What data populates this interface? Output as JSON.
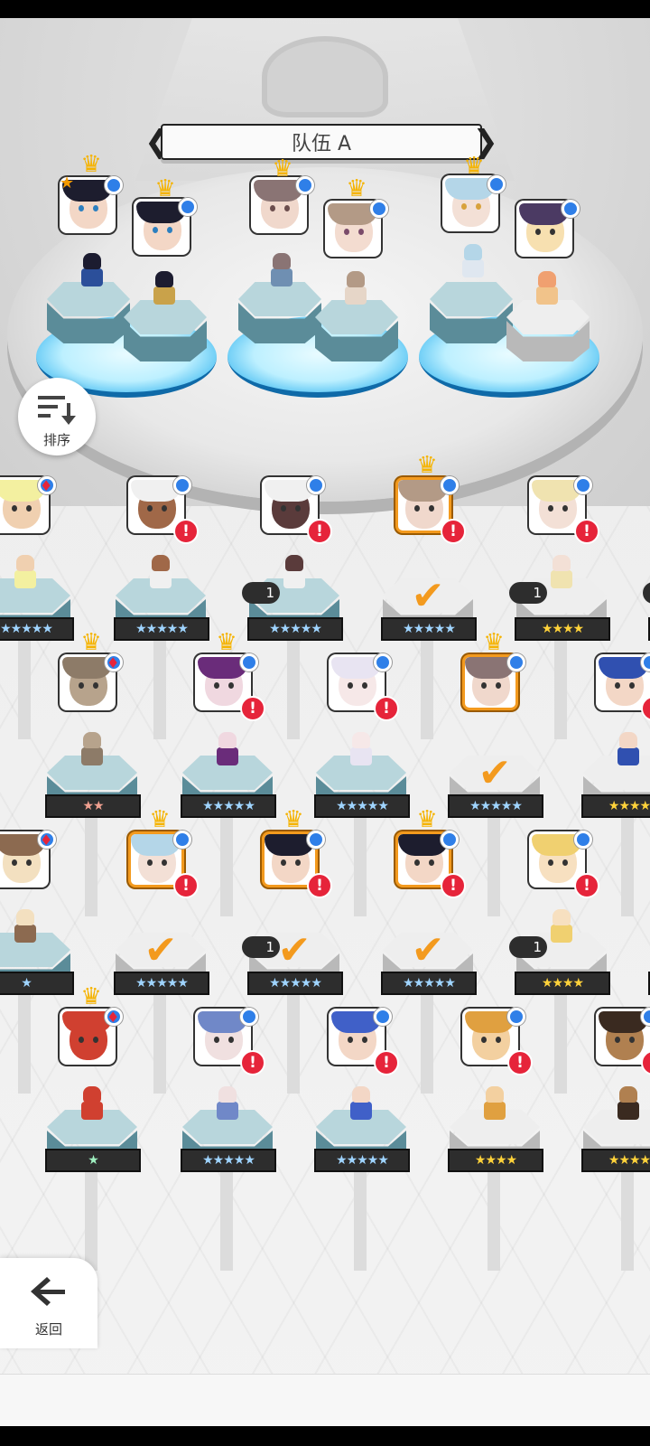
{
  "team": {
    "title": "队伍 A"
  },
  "sort": {
    "label": "排序"
  },
  "back": {
    "label": "返回"
  },
  "badges": {
    "alert": "!",
    "copies": "1",
    "check": "✔",
    "heart": "♦"
  },
  "colors": {
    "accent": "#f39a1e",
    "alert": "#e6243a",
    "info": "#2f7fe8",
    "crown": "#f5b300"
  },
  "stars": {
    "five": "★★★★★",
    "four": "★★★★",
    "two": "★★",
    "one": "★",
    "left_partial": "★"
  },
  "team_slots": [
    {
      "crown": true,
      "favorite": true
    },
    {
      "crown": true
    },
    {
      "crown": true
    },
    {
      "crown": true
    },
    {
      "crown": true
    },
    {
      "crown": false
    }
  ],
  "roster_rows": [
    [
      "partial",
      "5★",
      "5★ copies 1",
      "5★ selected",
      "4★ copies 1",
      "partial"
    ],
    [
      "2★",
      "5★",
      "5★",
      "5★ selected",
      "4★"
    ],
    [
      "partial",
      "5★ selected",
      "5★ selected copies 1",
      "5★ selected",
      "4★ copies 1",
      "partial"
    ],
    [
      "1★",
      "5★",
      "5★",
      "4★",
      "4★"
    ]
  ]
}
